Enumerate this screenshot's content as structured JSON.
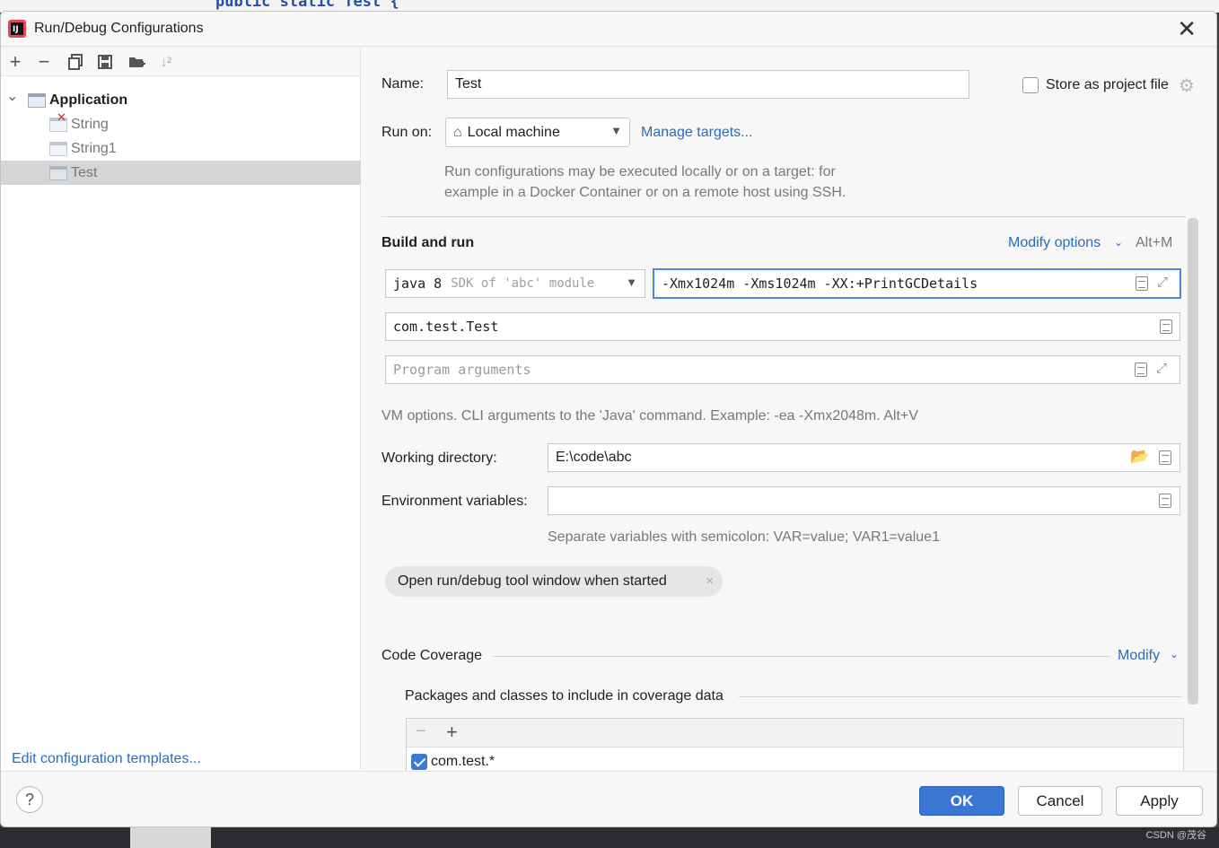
{
  "window": {
    "title": "Run/Debug Configurations",
    "close_symbol": "✕"
  },
  "left_toolbar": {
    "add": "+",
    "remove": "−",
    "sort": "↓²"
  },
  "tree": {
    "root": {
      "label": "Application",
      "chevron": "⌄"
    },
    "children": [
      {
        "label": "String"
      },
      {
        "label": "String1"
      },
      {
        "label": "Test"
      }
    ]
  },
  "edit_templates_link": "Edit configuration templates...",
  "form": {
    "name_label": "Name:",
    "name_value": "Test",
    "store_label": "Store as project file",
    "run_on_label": "Run on:",
    "run_on_value": "Local machine",
    "manage_targets": "Manage targets...",
    "run_on_hint_line1": "Run configurations may be executed locally or on a target: for",
    "run_on_hint_line2": "example in a Docker Container or on a remote host using SSH.",
    "build_and_run": "Build and run",
    "modify_options": "Modify options",
    "modify_shortcut": "Alt+M",
    "sdk_java": "java 8",
    "sdk_detail": "SDK of 'abc' module",
    "vm_options": "-Xmx1024m -Xms1024m -XX:+PrintGCDetails",
    "main_class": "com.test.Test",
    "program_args_placeholder": "Program arguments",
    "vm_hint": "VM options. CLI arguments to the 'Java' command. Example: -ea -Xmx2048m. Alt+V",
    "working_dir_label": "Working directory:",
    "working_dir_value": "E:\\code\\abc",
    "env_label": "Environment variables:",
    "env_value": "",
    "env_hint": "Separate variables with semicolon: VAR=value; VAR1=value1",
    "chip_label": "Open run/debug tool window when started",
    "chip_close": "×",
    "code_coverage": "Code Coverage",
    "modify": "Modify",
    "packages_label": "Packages and classes to include in coverage data",
    "pkg_remove": "−",
    "pkg_add": "+",
    "pkg_item": "com.test.*"
  },
  "buttons": {
    "help": "?",
    "ok": "OK",
    "cancel": "Cancel",
    "apply": "Apply"
  },
  "watermark": "CSDN @茂谷",
  "editor_code": "public static Test {"
}
